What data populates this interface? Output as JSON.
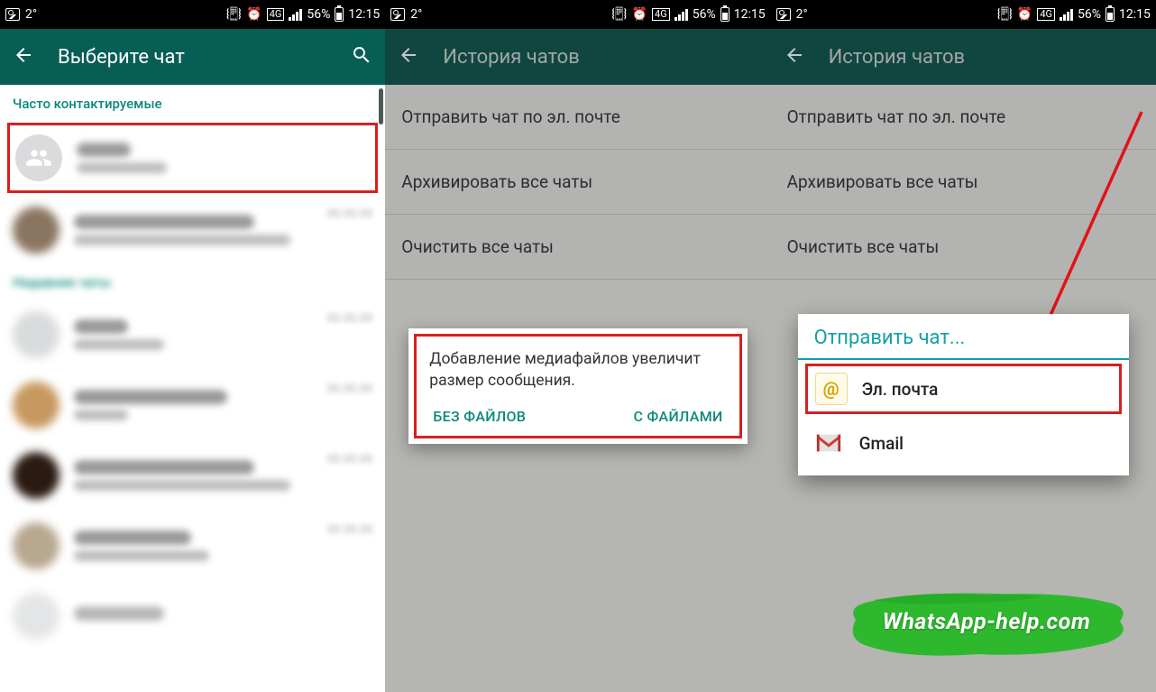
{
  "status": {
    "temp": "2°",
    "battery": "56%",
    "time": "12:15",
    "net": "4G"
  },
  "screen1": {
    "title": "Выберите чат",
    "section": "Часто контактируемые",
    "hidden_section": "Недавние чаты"
  },
  "screen2": {
    "title": "История чатов",
    "opt_email": "Отправить чат по эл. почте",
    "opt_archive": "Архивировать все чаты",
    "opt_clear": "Очистить все чаты",
    "dialog_msg": "Добавление медиафайлов увеличит размер сообщения.",
    "btn_without": "БЕЗ ФАЙЛОВ",
    "btn_with": "С ФАЙЛАМИ"
  },
  "screen3": {
    "title": "История чатов",
    "opt_email": "Отправить чат по эл. почте",
    "opt_archive": "Архивировать все чаты",
    "opt_clear": "Очистить все чаты",
    "dialog_title": "Отправить чат...",
    "share_email": "Эл. почта",
    "share_gmail": "Gmail"
  },
  "watermark": "WhatsApp-help.com"
}
